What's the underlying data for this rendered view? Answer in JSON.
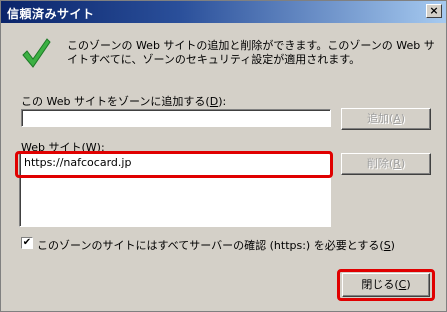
{
  "window": {
    "title": "信頼済みサイト",
    "close_glyph": "×"
  },
  "description": "このゾーンの Web サイトの追加と削除ができます。このゾーンの Web サイトすべてに、ゾーンのセキュリティ設定が適用されます。",
  "add_site": {
    "label_prefix": "この Web サイトをゾーンに追加する(",
    "label_key": "D",
    "label_suffix": "):",
    "input_value": "",
    "button_prefix": "追加(",
    "button_key": "A",
    "button_suffix": ")"
  },
  "sites": {
    "label_prefix": "Web サイト(",
    "label_key": "W",
    "label_suffix": "):",
    "items": [
      "https://nafcocard.jp"
    ],
    "remove_prefix": "削除(",
    "remove_key": "R",
    "remove_suffix": ")"
  },
  "require_https": {
    "checked": true,
    "check_glyph": "✔",
    "label_prefix": "このゾーンのサイトにはすべてサーバーの確認 (https:) を必要とする(",
    "label_key": "S",
    "label_suffix": ")"
  },
  "close_button": {
    "prefix": "閉じる(",
    "key": "C",
    "suffix": ")"
  },
  "colors": {
    "highlight": "#e00000",
    "check_icon": "#3cb043"
  }
}
